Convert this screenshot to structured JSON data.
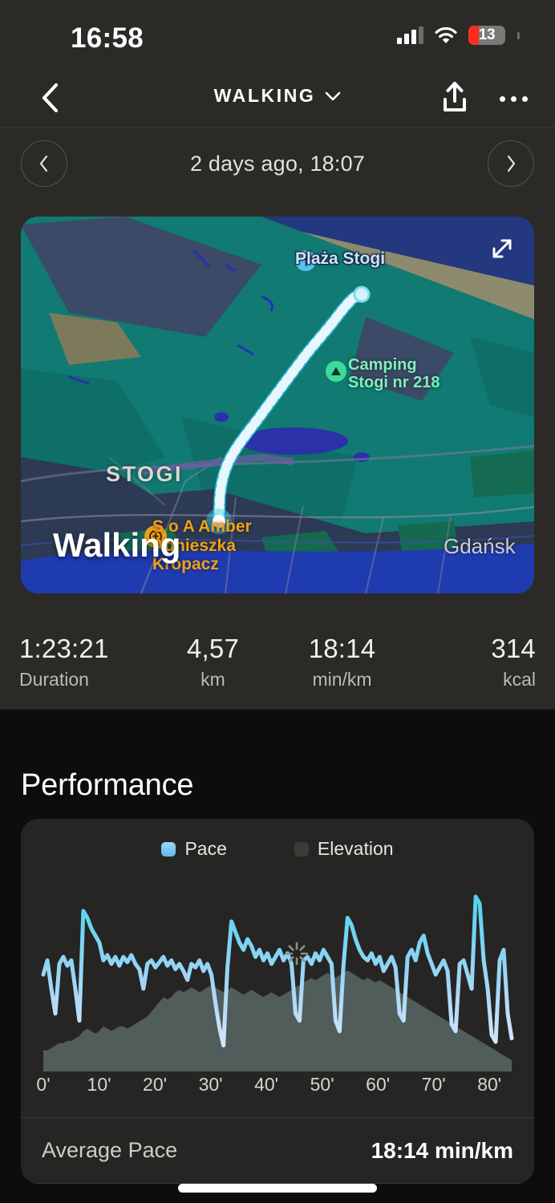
{
  "status_bar": {
    "time": "16:58",
    "battery_percent": "13",
    "signal_icon": "cellular-signal-icon",
    "wifi_icon": "wifi-icon",
    "battery_icon": "battery-icon"
  },
  "nav": {
    "back_icon": "chevron-left-icon",
    "title": "WALKING",
    "dropdown_icon": "chevron-down-icon",
    "share_icon": "share-upload-icon",
    "more_icon": "more-options-icon"
  },
  "date_nav": {
    "prev_icon": "chevron-left-icon",
    "next_icon": "chevron-right-icon",
    "label": "2 days ago, 18:07"
  },
  "map": {
    "expand_icon": "expand-diagonal-icon",
    "activity_label": "Walking",
    "labels": {
      "beach": "Plaża Stogi",
      "camping_line1": "Camping",
      "camping_line2": "Stogi nr 218",
      "district": "STOGI",
      "poi_line1": "S o A Amber",
      "poi_line2": "Agnieszka",
      "poi_line3": "Kropacz",
      "city": "Gdańsk"
    },
    "beach_icon": "beach-umbrella-icon",
    "camping_icon": "tent-icon",
    "poi_icon": "shop-marker-icon",
    "route_color_start": "#8fe3f5",
    "route_color_end": "#ffffff",
    "end_marker_color": "#3ed8f0"
  },
  "stats": [
    {
      "value": "1:23:21",
      "label": "Duration"
    },
    {
      "value": "4,57",
      "label": "km"
    },
    {
      "value": "18:14",
      "label": "min/km"
    },
    {
      "value": "314",
      "label": "kcal"
    }
  ],
  "performance": {
    "title": "Performance",
    "legend": [
      {
        "name": "Pace",
        "color": "#7cc6f2"
      },
      {
        "name": "Elevation",
        "color": "#3c3b38"
      }
    ],
    "average_pace_label": "Average Pace",
    "average_pace_value": "18:14 min/km",
    "marker_icon": "starburst-marker-icon"
  },
  "chart_data": {
    "type": "line",
    "title": "Performance",
    "xlabel": "",
    "ylabel": "",
    "grid": false,
    "legend_position": "top-center",
    "x_tick_labels": [
      "0'",
      "10'",
      "20'",
      "30'",
      "40'",
      "50'",
      "60'",
      "70'",
      "80'"
    ],
    "x_tick_values": [
      0,
      10,
      20,
      30,
      40,
      50,
      60,
      70,
      80
    ],
    "xlim": [
      0,
      84
    ],
    "series": [
      {
        "name": "Pace",
        "type": "line",
        "color": "#7cc6f2",
        "values": [
          52,
          60,
          44,
          30,
          58,
          62,
          57,
          60,
          44,
          26,
          88,
          84,
          78,
          74,
          70,
          60,
          63,
          58,
          62,
          57,
          62,
          59,
          63,
          58,
          55,
          44,
          58,
          60,
          56,
          59,
          62,
          57,
          60,
          55,
          58,
          54,
          49,
          58,
          56,
          60,
          54,
          58,
          52,
          36,
          22,
          12,
          56,
          82,
          76,
          70,
          66,
          72,
          68,
          62,
          66,
          60,
          64,
          58,
          62,
          66,
          60,
          64,
          58,
          30,
          26,
          60,
          62,
          58,
          64,
          60,
          66,
          62,
          58,
          26,
          20,
          58,
          84,
          80,
          72,
          66,
          62,
          60,
          64,
          58,
          62,
          54,
          58,
          62,
          56,
          30,
          26,
          62,
          66,
          60,
          70,
          74,
          64,
          58,
          52,
          56,
          60,
          54,
          24,
          20,
          58,
          60,
          52,
          44,
          96,
          92,
          60,
          44,
          18,
          14,
          60,
          66,
          30,
          16
        ]
      },
      {
        "name": "Elevation",
        "type": "area",
        "color": "#53605e",
        "values": [
          6,
          6,
          7,
          8,
          9,
          9,
          10,
          10,
          11,
          12,
          14,
          15,
          14,
          13,
          14,
          16,
          15,
          14,
          15,
          16,
          16,
          15,
          16,
          17,
          18,
          19,
          20,
          22,
          24,
          26,
          28,
          27,
          28,
          30,
          31,
          30,
          31,
          32,
          31,
          30,
          31,
          32,
          33,
          32,
          31,
          30,
          31,
          32,
          31,
          30,
          29,
          30,
          31,
          30,
          29,
          28,
          29,
          30,
          29,
          28,
          29,
          30,
          31,
          32,
          33,
          34,
          35,
          36,
          35,
          36,
          37,
          38,
          37,
          36,
          37,
          38,
          39,
          38,
          37,
          36,
          35,
          36,
          35,
          34,
          35,
          34,
          33,
          32,
          31,
          30,
          29,
          28,
          27,
          26,
          25,
          24,
          23,
          22,
          21,
          20,
          19,
          18,
          17,
          16,
          15,
          14,
          13,
          12,
          11,
          10,
          9,
          8,
          7,
          6,
          5,
          4,
          3,
          2
        ]
      }
    ]
  }
}
